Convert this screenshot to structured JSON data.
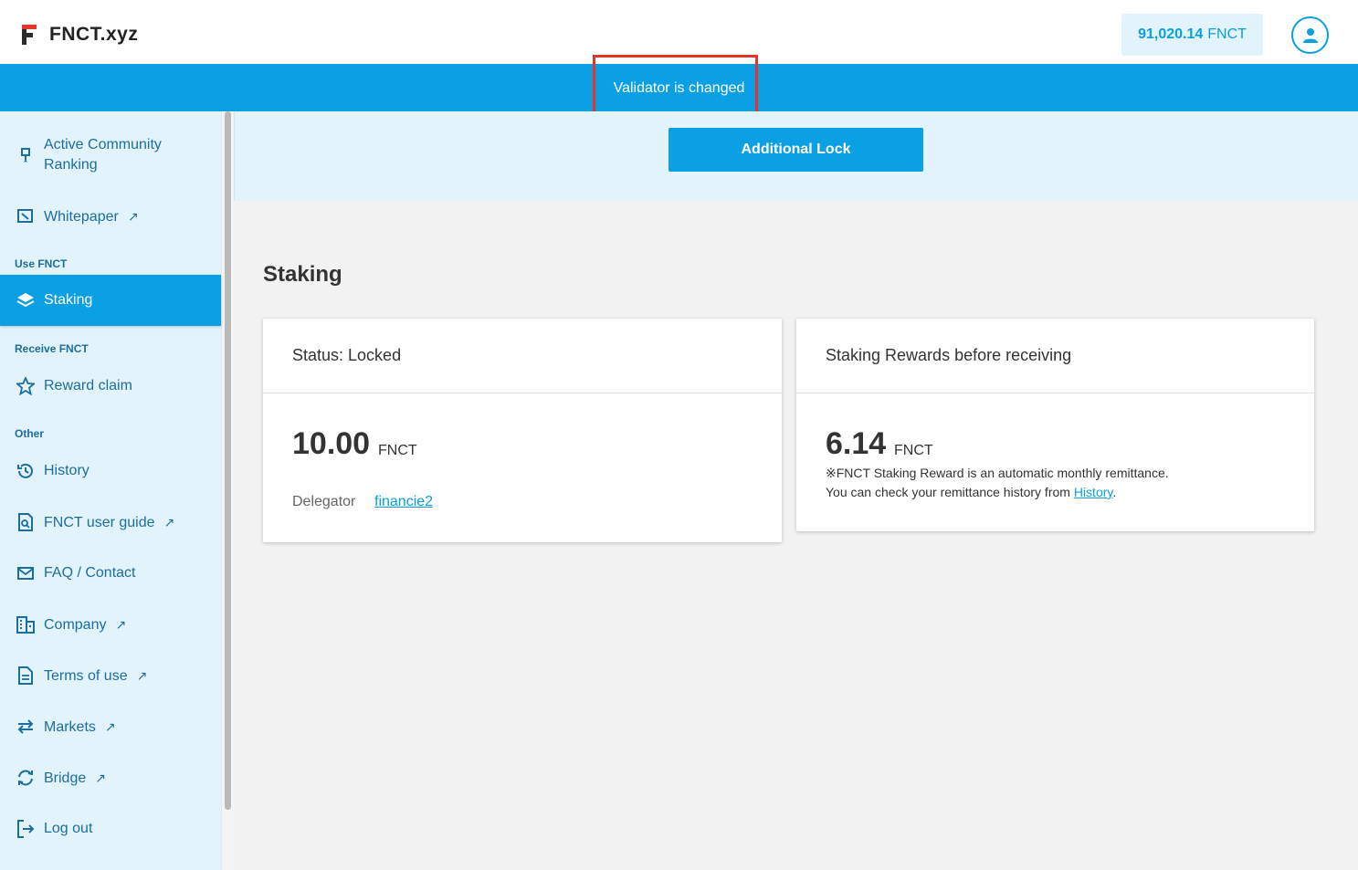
{
  "header": {
    "logo_text": "FNCT.xyz",
    "balance_value": "91,020.14",
    "balance_unit": "FNCT"
  },
  "banner": {
    "message": "Validator is changed"
  },
  "sidebar": {
    "items_top": [
      {
        "label_line1": "Active Community",
        "label_line2": "Ranking",
        "icon": "medal-icon"
      },
      {
        "label": "Whitepaper",
        "icon": "whitepaper-icon",
        "external": "↗"
      }
    ],
    "section_use": "Use FNCT",
    "staking": "Staking",
    "section_receive": "Receive FNCT",
    "reward_claim": "Reward claim",
    "section_other": "Other",
    "other_items": [
      {
        "label": "History",
        "icon": "history-icon"
      },
      {
        "label": "FNCT user guide",
        "icon": "guide-icon",
        "external": "↗"
      },
      {
        "label": "FAQ / Contact",
        "icon": "mail-icon"
      },
      {
        "label": "Company",
        "icon": "building-icon",
        "external": "↗"
      },
      {
        "label": "Terms of use",
        "icon": "document-icon",
        "external": "↗"
      },
      {
        "label": "Markets",
        "icon": "swap-icon",
        "external": "↗"
      },
      {
        "label": "Bridge",
        "icon": "bridge-icon",
        "external": "↗"
      },
      {
        "label": "Log out",
        "icon": "logout-icon"
      }
    ]
  },
  "main": {
    "additional_lock": "Additional Lock",
    "title": "Staking",
    "status_card": {
      "title": "Status: Locked",
      "amount": "10.00",
      "unit": "FNCT",
      "delegator_label": "Delegator",
      "delegator_value": "financie2"
    },
    "rewards_card": {
      "title": "Staking Rewards before receiving",
      "amount": "6.14",
      "unit": "FNCT",
      "note1": "※FNCT Staking Reward is an automatic monthly remittance.",
      "note2_prefix": "You can check your remittance history from ",
      "note2_link": "History",
      "note2_suffix": "."
    }
  },
  "colors": {
    "accent": "#0aa0e3",
    "sidebar_bg": "#e3f3fb",
    "highlight": "#e5352b",
    "logo_red": "#e2352b"
  }
}
